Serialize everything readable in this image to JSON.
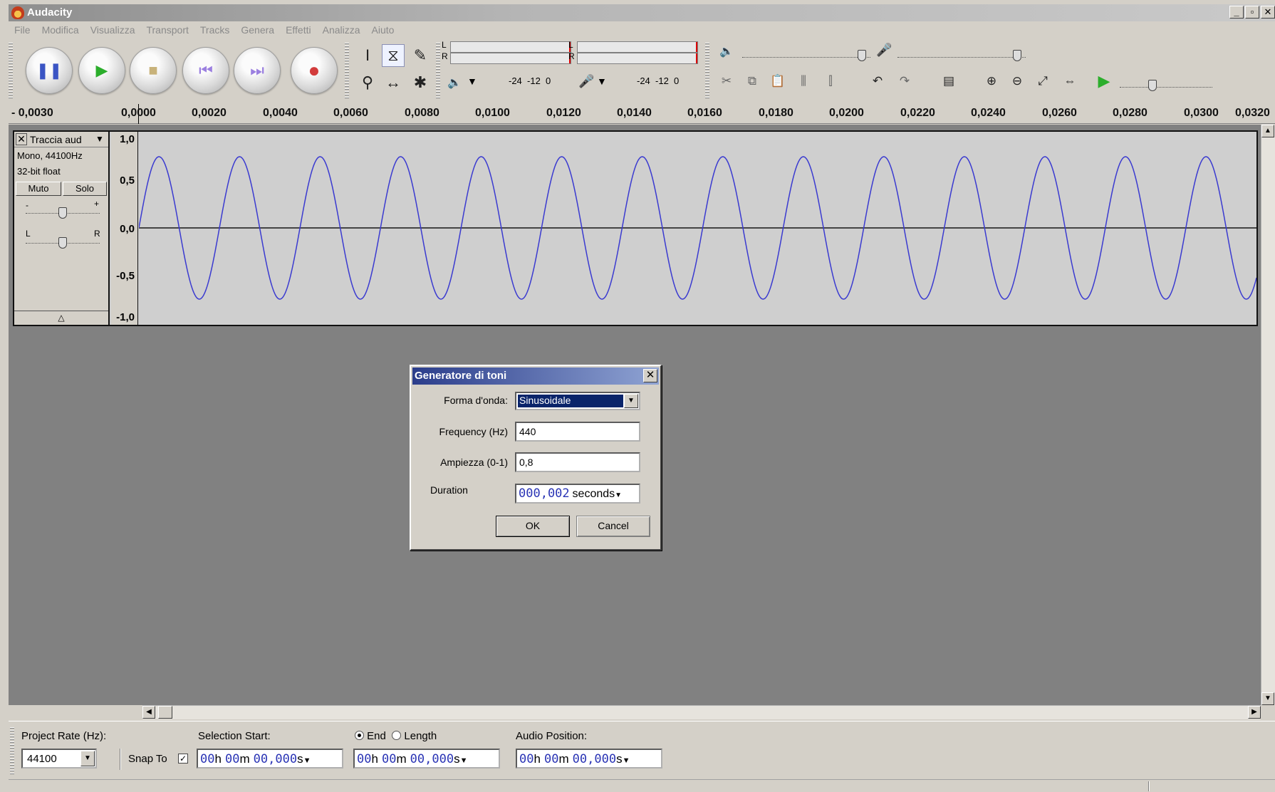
{
  "window": {
    "title": "Audacity",
    "controls": [
      "_",
      "▫",
      "✕"
    ]
  },
  "menu": [
    "File",
    "Modifica",
    "Visualizza",
    "Transport",
    "Tracks",
    "Genera",
    "Effetti",
    "Analizza",
    "Aiuto"
  ],
  "meters": {
    "play_l": "L",
    "play_r": "R",
    "rec_l": "L",
    "rec_r": "R",
    "play_scale": "-24  -12  0",
    "rec_scale": "-24  -12  0"
  },
  "ruler": {
    "ticks": [
      "- 0,0030",
      "0,0000",
      "0,0020",
      "0,0040",
      "0,0060",
      "0,0080",
      "0,0100",
      "0,0120",
      "0,0140",
      "0,0160",
      "0,0180",
      "0,0200",
      "0,0220",
      "0,0240",
      "0,0260",
      "0,0280",
      "0,0300",
      "0,0320"
    ]
  },
  "track": {
    "name": "Traccia aud",
    "format_line1": "Mono, 44100Hz",
    "format_line2": "32-bit float",
    "mute": "Muto",
    "solo": "Solo",
    "gain_minus": "-",
    "gain_plus": "+",
    "pan_left": "L",
    "pan_right": "R",
    "gain": 0.5,
    "pan": 0.5,
    "amplitude_ticks": [
      "1,0",
      "0,5",
      "0,0",
      "-0,5",
      "-1,0"
    ],
    "waveform": {
      "frequency_hz": 440,
      "amplitude": 0.8,
      "color": "#3a3ad0"
    }
  },
  "dialog": {
    "title": "Generatore di toni",
    "waveform_label": "Forma d'onda:",
    "waveform_value": "Sinusoidale",
    "frequency_label": "Frequency (Hz)",
    "frequency_value": "440",
    "amplitude_label": "Ampiezza (0-1)",
    "amplitude_value": "0,8",
    "duration_label": "Duration",
    "duration_digits": "000,002",
    "duration_unit": "seconds",
    "ok": "OK",
    "cancel": "Cancel"
  },
  "selection_bar": {
    "project_rate_label": "Project Rate (Hz):",
    "project_rate_value": "44100",
    "snap_to_label": "Snap To",
    "snap_to_checked": true,
    "selection_start_label": "Selection Start:",
    "end_label": "End",
    "length_label": "Length",
    "audio_position_label": "Audio Position:",
    "sel_start": {
      "h": "00",
      "m": "00",
      "s": "00,000"
    },
    "sel_end": {
      "h": "00",
      "m": "00",
      "s": "00,000"
    },
    "audio_pos": {
      "h": "00",
      "m": "00",
      "s": "00,000"
    },
    "unit_h": "h",
    "unit_m": "m",
    "unit_s": "s"
  }
}
